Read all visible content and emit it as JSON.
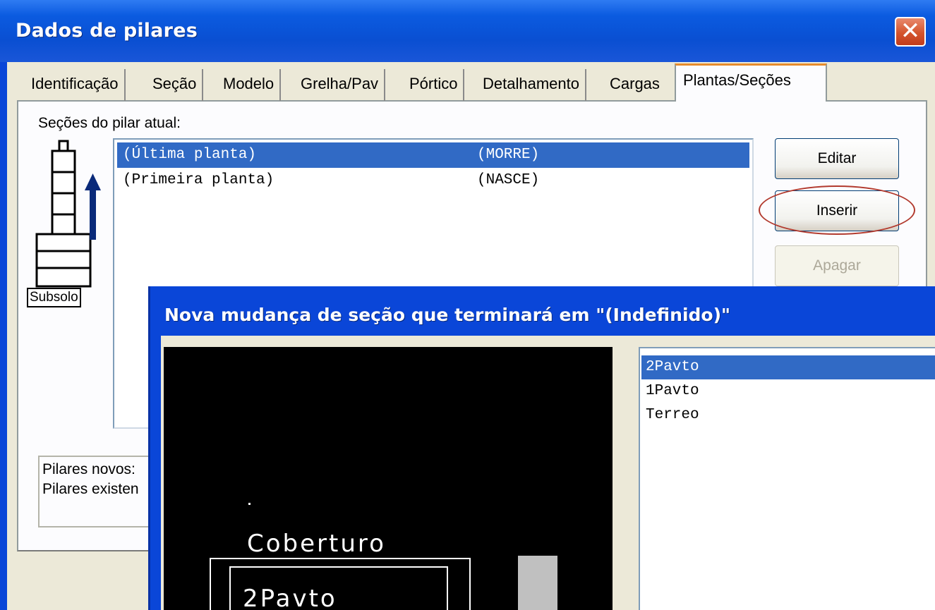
{
  "window": {
    "title": "Dados de pilares",
    "close_glyph": "✕"
  },
  "tabs": [
    {
      "label": "Identificação"
    },
    {
      "label": "Seção"
    },
    {
      "label": "Modelo"
    },
    {
      "label": "Grelha/Pav"
    },
    {
      "label": "Pórtico"
    },
    {
      "label": "Detalhamento"
    },
    {
      "label": "Cargas"
    },
    {
      "label": "Plantas/Seções",
      "active": true
    }
  ],
  "sections": {
    "label": "Seções do pilar atual:",
    "rows": [
      {
        "planta": "(Última planta)",
        "acao": "(MORRE)",
        "selected": true
      },
      {
        "planta": "(Primeira planta)",
        "acao": "(NASCE)",
        "selected": false
      }
    ]
  },
  "pillar_graphic": {
    "base_label": "Subsolo",
    "icon": "pillar-floors-icon",
    "arrow": "up-arrow-icon"
  },
  "buttons": {
    "edit": "Editar",
    "insert": "Inserir",
    "delete": "Apagar"
  },
  "info": {
    "line1": "Pilares novos:",
    "line2": "Pilares existen"
  },
  "dialog": {
    "title": "Nova mudança de seção que terminará em \"(Indefinido)\"",
    "floors": [
      {
        "label": "2Pavto",
        "selected": true
      },
      {
        "label": "1Pavto",
        "selected": false
      },
      {
        "label": "Terreo",
        "selected": false
      }
    ],
    "preview": {
      "label_top": "Coberturo",
      "label_inner": "2Pavto"
    }
  },
  "colors": {
    "title_blue": "#0a46d8",
    "selection": "#316ac5",
    "highlight_circle": "#b23a2e"
  }
}
